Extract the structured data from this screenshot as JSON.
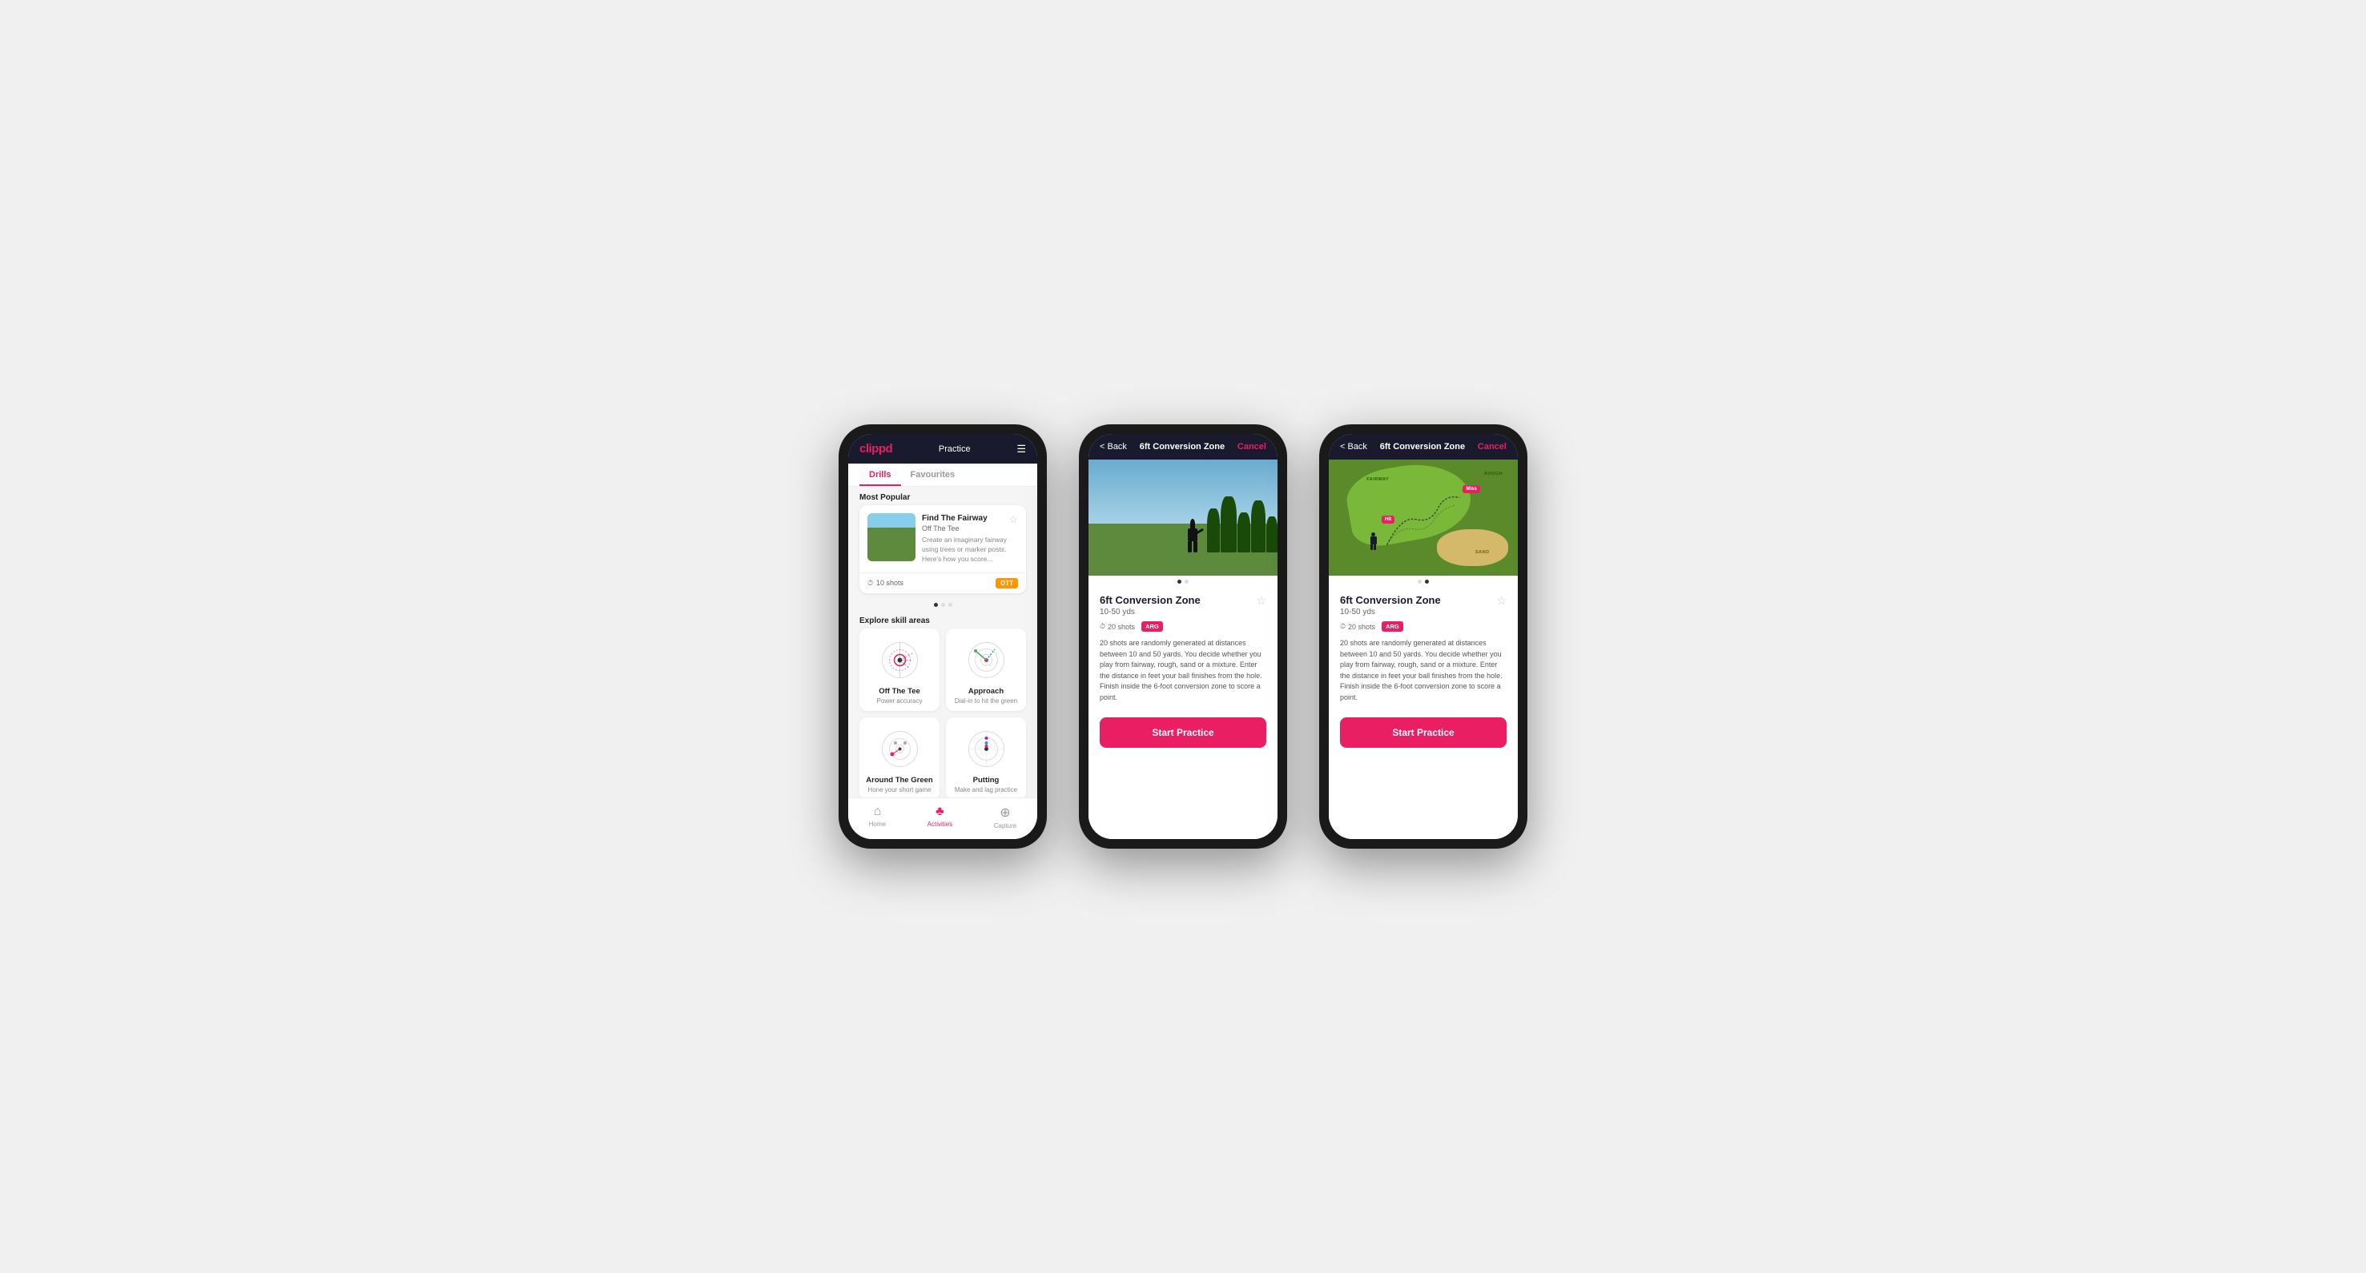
{
  "phone1": {
    "header": {
      "logo": "clippd",
      "title": "Practice",
      "menu_icon": "☰"
    },
    "tabs": [
      {
        "label": "Drills",
        "active": true
      },
      {
        "label": "Favourites",
        "active": false
      }
    ],
    "most_popular": {
      "label": "Most Popular",
      "card": {
        "title": "Find The Fairway",
        "subtitle": "Off The Tee",
        "description": "Create an imaginary fairway using trees or marker posts. Here's how you score...",
        "shots": "10 shots",
        "badge": "OTT"
      },
      "dots": [
        true,
        false,
        false
      ]
    },
    "explore": {
      "label": "Explore skill areas",
      "skills": [
        {
          "name": "Off The Tee",
          "desc": "Power accuracy",
          "icon": "ott"
        },
        {
          "name": "Approach",
          "desc": "Dial-in to hit the green",
          "icon": "approach"
        },
        {
          "name": "Around The Green",
          "desc": "Hone your short game",
          "icon": "arg"
        },
        {
          "name": "Putting",
          "desc": "Make and lag practice",
          "icon": "putting"
        }
      ]
    },
    "bottom_nav": [
      {
        "label": "Home",
        "icon": "⌂",
        "active": false
      },
      {
        "label": "Activities",
        "icon": "♣",
        "active": true
      },
      {
        "label": "Capture",
        "icon": "⊕",
        "active": false
      }
    ]
  },
  "phone2": {
    "header": {
      "back_label": "< Back",
      "title": "6ft Conversion Zone",
      "cancel_label": "Cancel"
    },
    "dots": [
      true,
      false
    ],
    "drill": {
      "title": "6ft Conversion Zone",
      "range": "10-50 yds",
      "shots": "20 shots",
      "badge": "ARG",
      "fav": "☆",
      "description": "20 shots are randomly generated at distances between 10 and 50 yards. You decide whether you play from fairway, rough, sand or a mixture. Enter the distance in feet your ball finishes from the hole. Finish inside the 6-foot conversion zone to score a point."
    },
    "start_button": "Start Practice"
  },
  "phone3": {
    "header": {
      "back_label": "< Back",
      "title": "6ft Conversion Zone",
      "cancel_label": "Cancel"
    },
    "dots": [
      false,
      true
    ],
    "drill": {
      "title": "6ft Conversion Zone",
      "range": "10-50 yds",
      "shots": "20 shots",
      "badge": "ARG",
      "fav": "☆",
      "description": "20 shots are randomly generated at distances between 10 and 50 yards. You decide whether you play from fairway, rough, sand or a mixture. Enter the distance in feet your ball finishes from the hole. Finish inside the 6-foot conversion zone to score a point."
    },
    "map": {
      "labels": {
        "fairway": "FAIRWAY",
        "rough": "ROUGH",
        "sand": "SAND"
      },
      "pins": [
        {
          "label": "Miss",
          "type": "miss"
        },
        {
          "label": "Hit",
          "type": "hit"
        }
      ]
    },
    "start_button": "Start Practice"
  }
}
